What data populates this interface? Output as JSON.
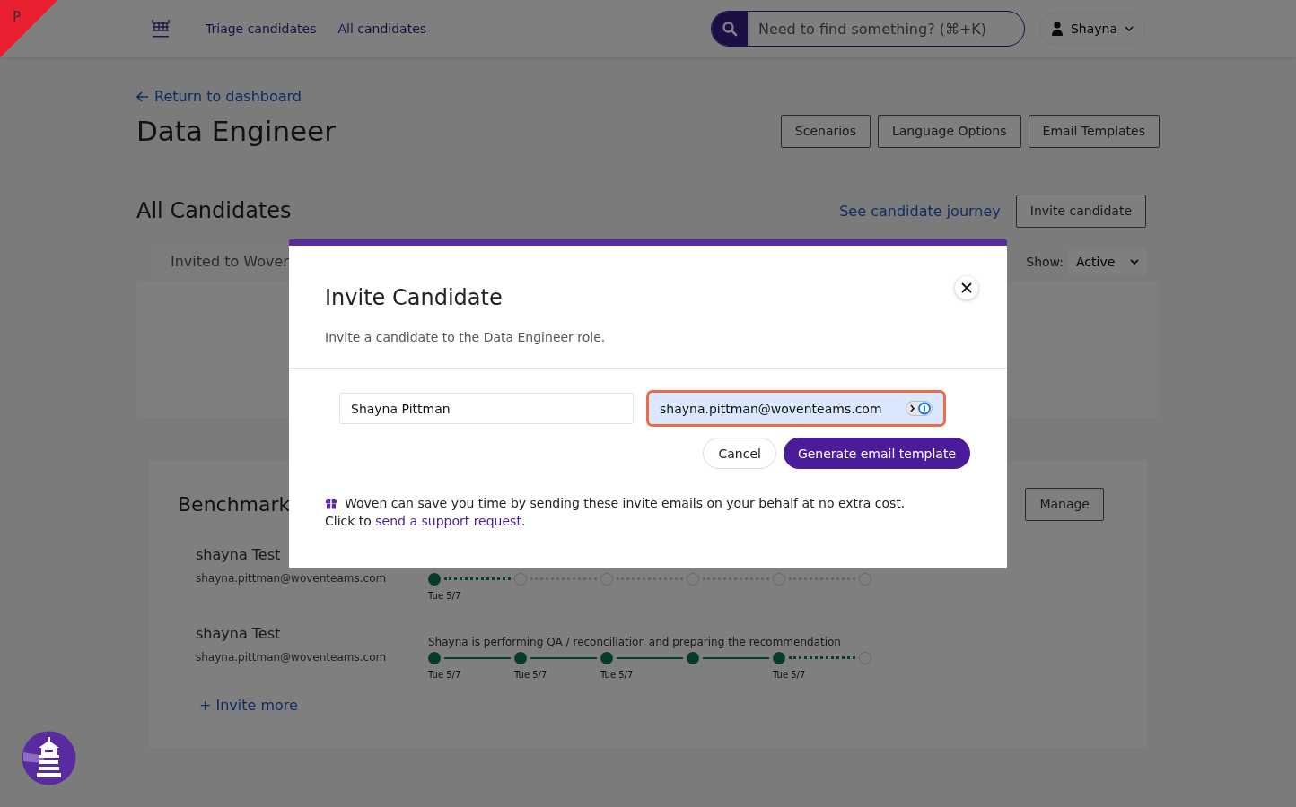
{
  "env_badge": "P",
  "nav": {
    "links": [
      "Triage candidates",
      "All candidates"
    ],
    "search": {
      "placeholder": "Need to find something? (⌘+K)"
    },
    "user": "Shayna"
  },
  "back_link": "Return to dashboard",
  "title": "Data Engineer",
  "header_buttons": [
    "Scenarios",
    "Language Options",
    "Email Templates"
  ],
  "candidates": {
    "title": "All Candidates",
    "journey_link": "See candidate journey",
    "invite_button": "Invite candidate",
    "tabs": [
      {
        "label": "Invited to Woven",
        "selected": true
      }
    ],
    "show": {
      "label": "Show:",
      "value": "Active"
    }
  },
  "benchmark": {
    "title": "Benchmark",
    "manage_button": "Manage",
    "rows": [
      {
        "name": "shayna Test",
        "email": "shayna.pittman@woventeams.com",
        "steps": [
          {
            "done": true,
            "date": "Tue 5/7"
          },
          {
            "done": false
          },
          {
            "done": false
          },
          {
            "done": false
          },
          {
            "done": false
          },
          {
            "done": false
          }
        ]
      },
      {
        "name": "shayna Test",
        "email": "shayna.pittman@woventeams.com",
        "status": "Shayna is performing QA / reconciliation and preparing the recommendation",
        "steps": [
          {
            "done": true,
            "date": "Tue 5/7"
          },
          {
            "done": true,
            "date": "Tue 5/7"
          },
          {
            "done": true,
            "date": "Tue 5/7"
          },
          {
            "done": true
          },
          {
            "done": true,
            "date": "Tue 5/7"
          },
          {
            "done": false
          }
        ]
      }
    ],
    "invite_more": "+ Invite more"
  },
  "modal": {
    "title": "Invite Candidate",
    "subtitle": "Invite a candidate to the Data Engineer role.",
    "name_field": {
      "value": "Shayna Pittman"
    },
    "email_field": {
      "value": "shayna.pittman@woventeams.com",
      "focused": true
    },
    "buttons": [
      {
        "label": "Cancel",
        "kind": "secondary"
      },
      {
        "label": "Generate email template",
        "kind": "primary"
      }
    ],
    "note": "Woven can save you time by sending these invite emails on your behalf at no extra cost.",
    "note_prefix": "Click to ",
    "note_link": "send a support request",
    "note_suffix": "."
  }
}
